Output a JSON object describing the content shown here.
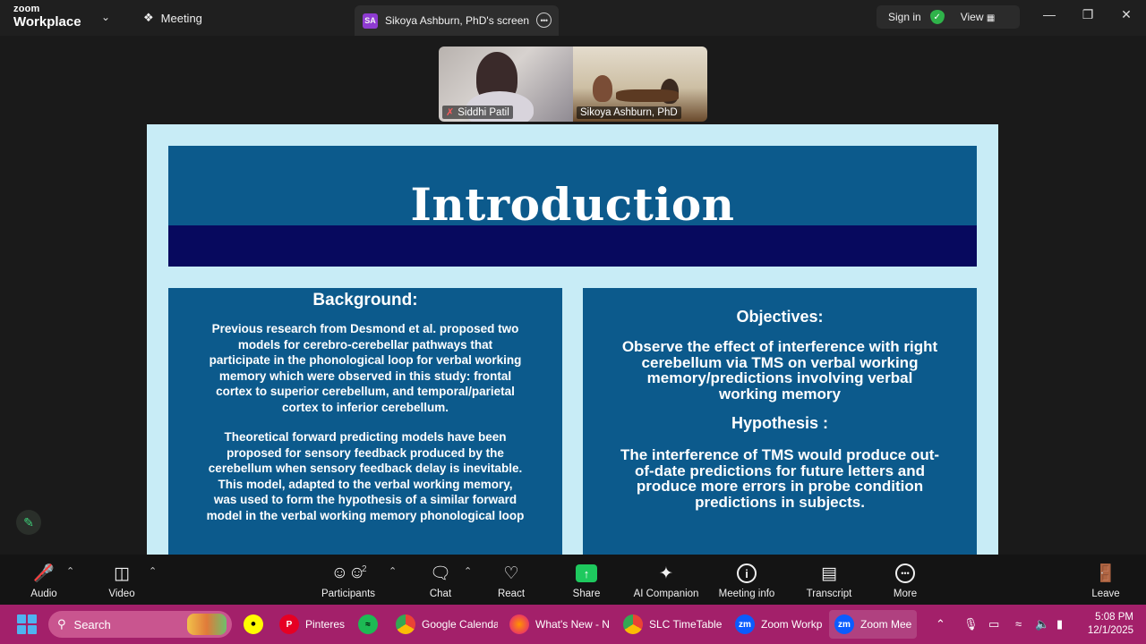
{
  "titlebar": {
    "logo_top": "zoom",
    "logo_bottom": "Workplace",
    "meeting_tab": "Meeting",
    "screen_tab_badge": "SA",
    "screen_tab_label": "Sikoya Ashburn, PhD's screen",
    "sign_in": "Sign in",
    "view": "View"
  },
  "participants_video": [
    {
      "name": "Siddhi Patil",
      "muted": true
    },
    {
      "name": "Sikoya Ashburn, PhD",
      "muted": false
    }
  ],
  "slide": {
    "title": "Introduction",
    "background_heading": "Background:",
    "background_p1": "Previous research from Desmond et al. proposed two models for cerebro-cerebellar pathways that participate in the phonological loop for verbal working memory which were observed in this study: frontal cortex to superior cerebellum, and temporal/parietal cortex to inferior cerebellum.",
    "background_p2": "Theoretical forward predicting models have been proposed for sensory feedback produced by the cerebellum when sensory feedback delay is inevitable. This model, adapted to the verbal working memory, was used to form the hypothesis of a similar forward model in the verbal working memory phonological loop",
    "objectives_heading": "Objectives:",
    "objectives_text": "Observe the effect of interference with right cerebellum via TMS on verbal working memory/predictions involving verbal working memory",
    "hypothesis_heading": "Hypothesis :",
    "hypothesis_text": "The interference of TMS would produce out-of-date predictions for future letters and produce more errors in probe condition predictions in subjects."
  },
  "toolbar": {
    "audio": "Audio",
    "video": "Video",
    "participants": "Participants",
    "participants_count": "2",
    "chat": "Chat",
    "react": "React",
    "share": "Share",
    "ai_companion": "AI Companion",
    "meeting_info": "Meeting info",
    "transcript": "Transcript",
    "more": "More",
    "leave": "Leave"
  },
  "taskbar": {
    "search_placeholder": "Search",
    "items": [
      "Pinteres",
      "Google Calenda",
      "What's New - N",
      "SLC TimeTable -",
      "Zoom Workp",
      "Zoom Mee"
    ],
    "time": "5:08 PM",
    "date": "12/1/2025"
  },
  "colors": {
    "slide_bg": "#c8ecf6",
    "panel_blue": "#0c5a8c",
    "title_band": "#07095e",
    "taskbar": "#a3206a",
    "share_green": "#1ec95e"
  }
}
